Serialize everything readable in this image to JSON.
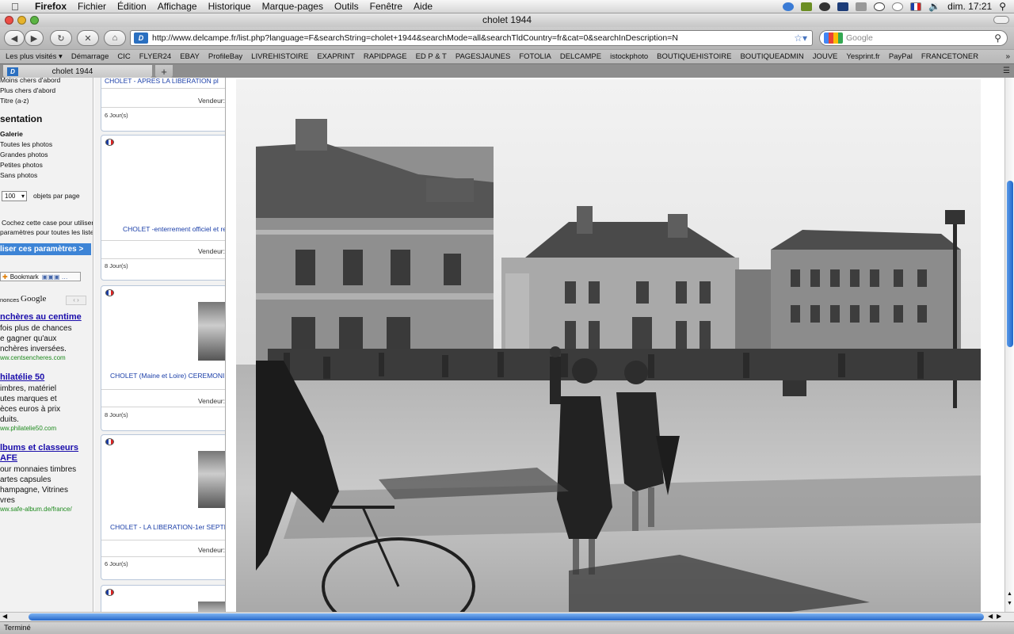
{
  "menubar": {
    "app": "Firefox",
    "items": [
      "Fichier",
      "Édition",
      "Affichage",
      "Historique",
      "Marque-pages",
      "Outils",
      "Fenêtre",
      "Aide"
    ],
    "clock": "dim. 17:21"
  },
  "window": {
    "title": "cholet 1944"
  },
  "nav": {
    "url": "http://www.delcampe.fr/list.php?language=F&searchString=cholet+1944&searchMode=all&searchTldCountry=fr&cat=0&searchInDescription=N",
    "site_badge": "D",
    "search_placeholder": "Google"
  },
  "bookmarks": [
    "Les plus visités ▾",
    "Démarrage",
    "CIC",
    "FLYER24",
    "EBAY",
    "ProfileBay",
    "LIVREHISTOIRE",
    "EXAPRINT",
    "RAPIDPAGE",
    "ED P & T",
    "PAGESJAUNES",
    "FOTOLIA",
    "DELCAMPE",
    "istockphoto",
    "BOUTIQUEHISTOIRE",
    "BOUTIQUEADMIN",
    "JOUVE",
    "Yesprint.fr",
    "PayPal",
    "FRANCETONER"
  ],
  "tab": {
    "label": "cholet 1944",
    "favicon": "D"
  },
  "sidebar": {
    "sort_items": [
      "Moins chers d'abord",
      "Plus chers d'abord",
      "Titre (a-z)"
    ],
    "presentation_heading": "sentation",
    "presentation_items": [
      "Galerie",
      "Toutes les photos",
      "Grandes photos",
      "Petites photos",
      "Sans photos"
    ],
    "per_page_value": "100",
    "per_page_label": "objets par page",
    "checkbox_text_1": "Cochez cette case pour utiliser",
    "checkbox_text_2": "paramètres pour toutes les listes",
    "apply_button": "liser ces paramètres >",
    "bookmark_button": "Bookmark",
    "ads_label": "nonces",
    "ads_google": "Google",
    "ads": [
      {
        "title": "nchères au centime",
        "lines": [
          "fois plus de chances",
          "e gagner qu'aux",
          "nchères inversées."
        ],
        "url": "ww.centsencheres.com"
      },
      {
        "title": "hilatélie 50",
        "lines": [
          "imbres, matériel",
          "utes marques et",
          "èces euros à prix",
          "duits."
        ],
        "url": "ww.philatelie50.com"
      },
      {
        "title": "lbums et classeurs",
        "title2": "AFE",
        "lines": [
          "our monnaies timbres",
          "artes capsules",
          "hampagne, Vitrines",
          "vres"
        ],
        "url": "ww.safe-album.de/france/"
      }
    ]
  },
  "listing": {
    "cards": [
      {
        "title": "CHOLET - APRES LA LIBERATION pl",
        "vendor": "Vendeur:",
        "days": "6 Jour(s)"
      },
      {
        "title": "CHOLET -enterrement officiel et rel",
        "vendor": "Vendeur:",
        "days": "8 Jour(s)"
      },
      {
        "title": "CHOLET (Maine et Loire) CEREMONIE",
        "vendor": "Vendeur:",
        "days": "8 Jour(s)"
      },
      {
        "title": "CHOLET - LA LIBERATION-1er SEPTE",
        "vendor": "Vendeur:",
        "days": "6 Jour(s)"
      }
    ]
  },
  "status": {
    "text": "Terminé"
  }
}
